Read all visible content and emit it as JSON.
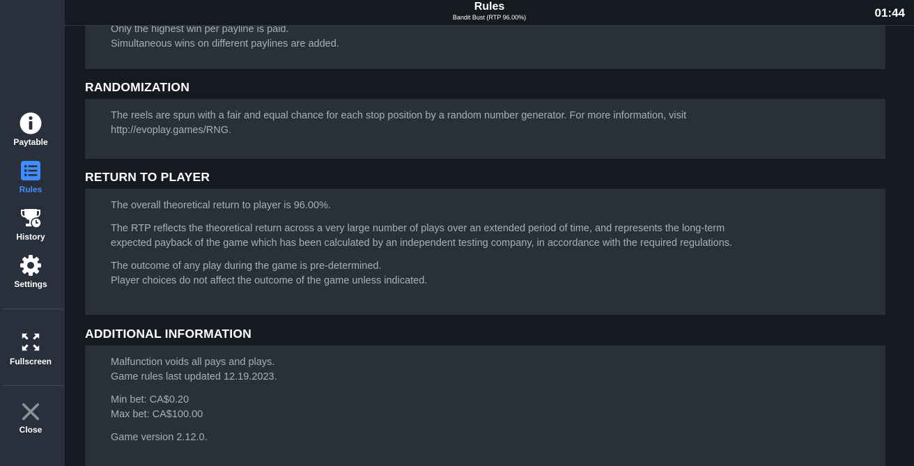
{
  "header": {
    "title": "Rules",
    "subtitle": "Bandit Bust (RTP 96.00%)",
    "clock": "01:44"
  },
  "sidebar": {
    "items": [
      {
        "label": "Paytable",
        "icon": "info-icon"
      },
      {
        "label": "Rules",
        "icon": "list-icon",
        "active": true
      },
      {
        "label": "History",
        "icon": "trophy-clock-icon"
      },
      {
        "label": "Settings",
        "icon": "gear-icon"
      },
      {
        "label": "Fullscreen",
        "icon": "fullscreen-icon"
      },
      {
        "label": "Close",
        "icon": "close-icon"
      }
    ],
    "accent_color": "#3f8dff"
  },
  "sections": {
    "paylines": {
      "lines": [
        "Only the highest win per payline is paid.",
        "Simultaneous wins on different paylines are added."
      ]
    },
    "randomization": {
      "title": "RANDOMIZATION",
      "lines": [
        "The reels are spun with a fair and equal chance for each stop position by a random number generator. For more information, visit",
        "http://evoplay.games/RNG."
      ]
    },
    "rtp": {
      "title": "RETURN TO PLAYER",
      "p1": "The overall theoretical return to player is 96.00%.",
      "p2a": "The RTP reflects the theoretical return across a very large number of plays over an extended period of time, and represents the long-term",
      "p2b": "expected payback of the game which has been calculated by an independent testing company, in accordance with the required regulations.",
      "p3a": "The outcome of any play during the game is pre-determined.",
      "p3b": "Player choices do not affect the outcome of the game unless indicated."
    },
    "additional": {
      "title": "ADDITIONAL INFORMATION",
      "malfunction": "Malfunction voids all pays and plays.",
      "updated": "Game rules last updated 12.19.2023.",
      "min_bet": "Min bet: CA$0.20",
      "max_bet": "Max bet: CA$100.00",
      "version": "Game version 2.12.0."
    }
  }
}
